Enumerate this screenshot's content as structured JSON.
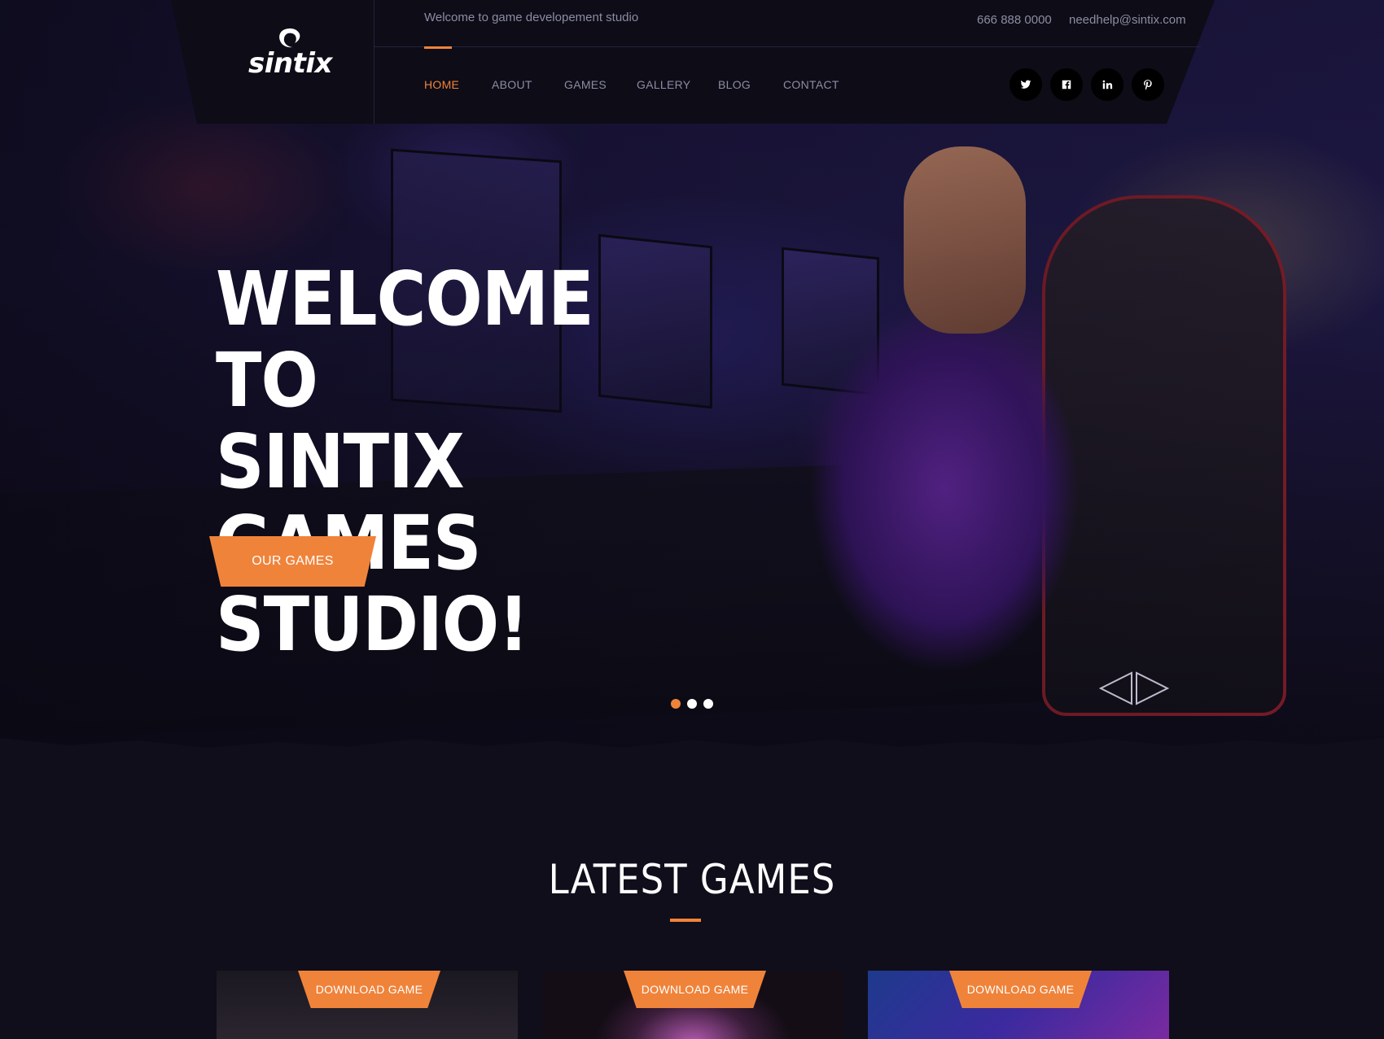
{
  "brand": {
    "name": "sintix"
  },
  "topbar": {
    "tagline": "Welcome to game developement studio",
    "phone": "666 888 0000",
    "email": "needhelp@sintix.com"
  },
  "nav": {
    "items": [
      {
        "label": "HOME",
        "active": true
      },
      {
        "label": "ABOUT",
        "active": false
      },
      {
        "label": "GAMES",
        "active": false
      },
      {
        "label": "GALLERY",
        "active": false
      },
      {
        "label": "BLOG",
        "active": false
      },
      {
        "label": "CONTACT",
        "active": false
      }
    ]
  },
  "social": [
    {
      "icon": "twitter-icon"
    },
    {
      "icon": "facebook-icon"
    },
    {
      "icon": "linkedin-icon"
    },
    {
      "icon": "pinterest-icon"
    }
  ],
  "hero": {
    "title_line1": "WELCOME TO",
    "title_line2": "SINTIX GAMES",
    "title_line3": "STUDIO!",
    "cta_label": "OUR GAMES",
    "slides": 3,
    "active_slide": 1
  },
  "latest_games": {
    "title": "LATEST GAMES",
    "cards": [
      {
        "badge": "DOWNLOAD GAME"
      },
      {
        "badge": "DOWNLOAD GAME"
      },
      {
        "badge": "DOWNLOAD GAME"
      }
    ]
  },
  "colors": {
    "accent": "#f0833a",
    "background": "#0f0e1a",
    "header": "#0d0c17",
    "muted_text": "#8d8ca3"
  }
}
